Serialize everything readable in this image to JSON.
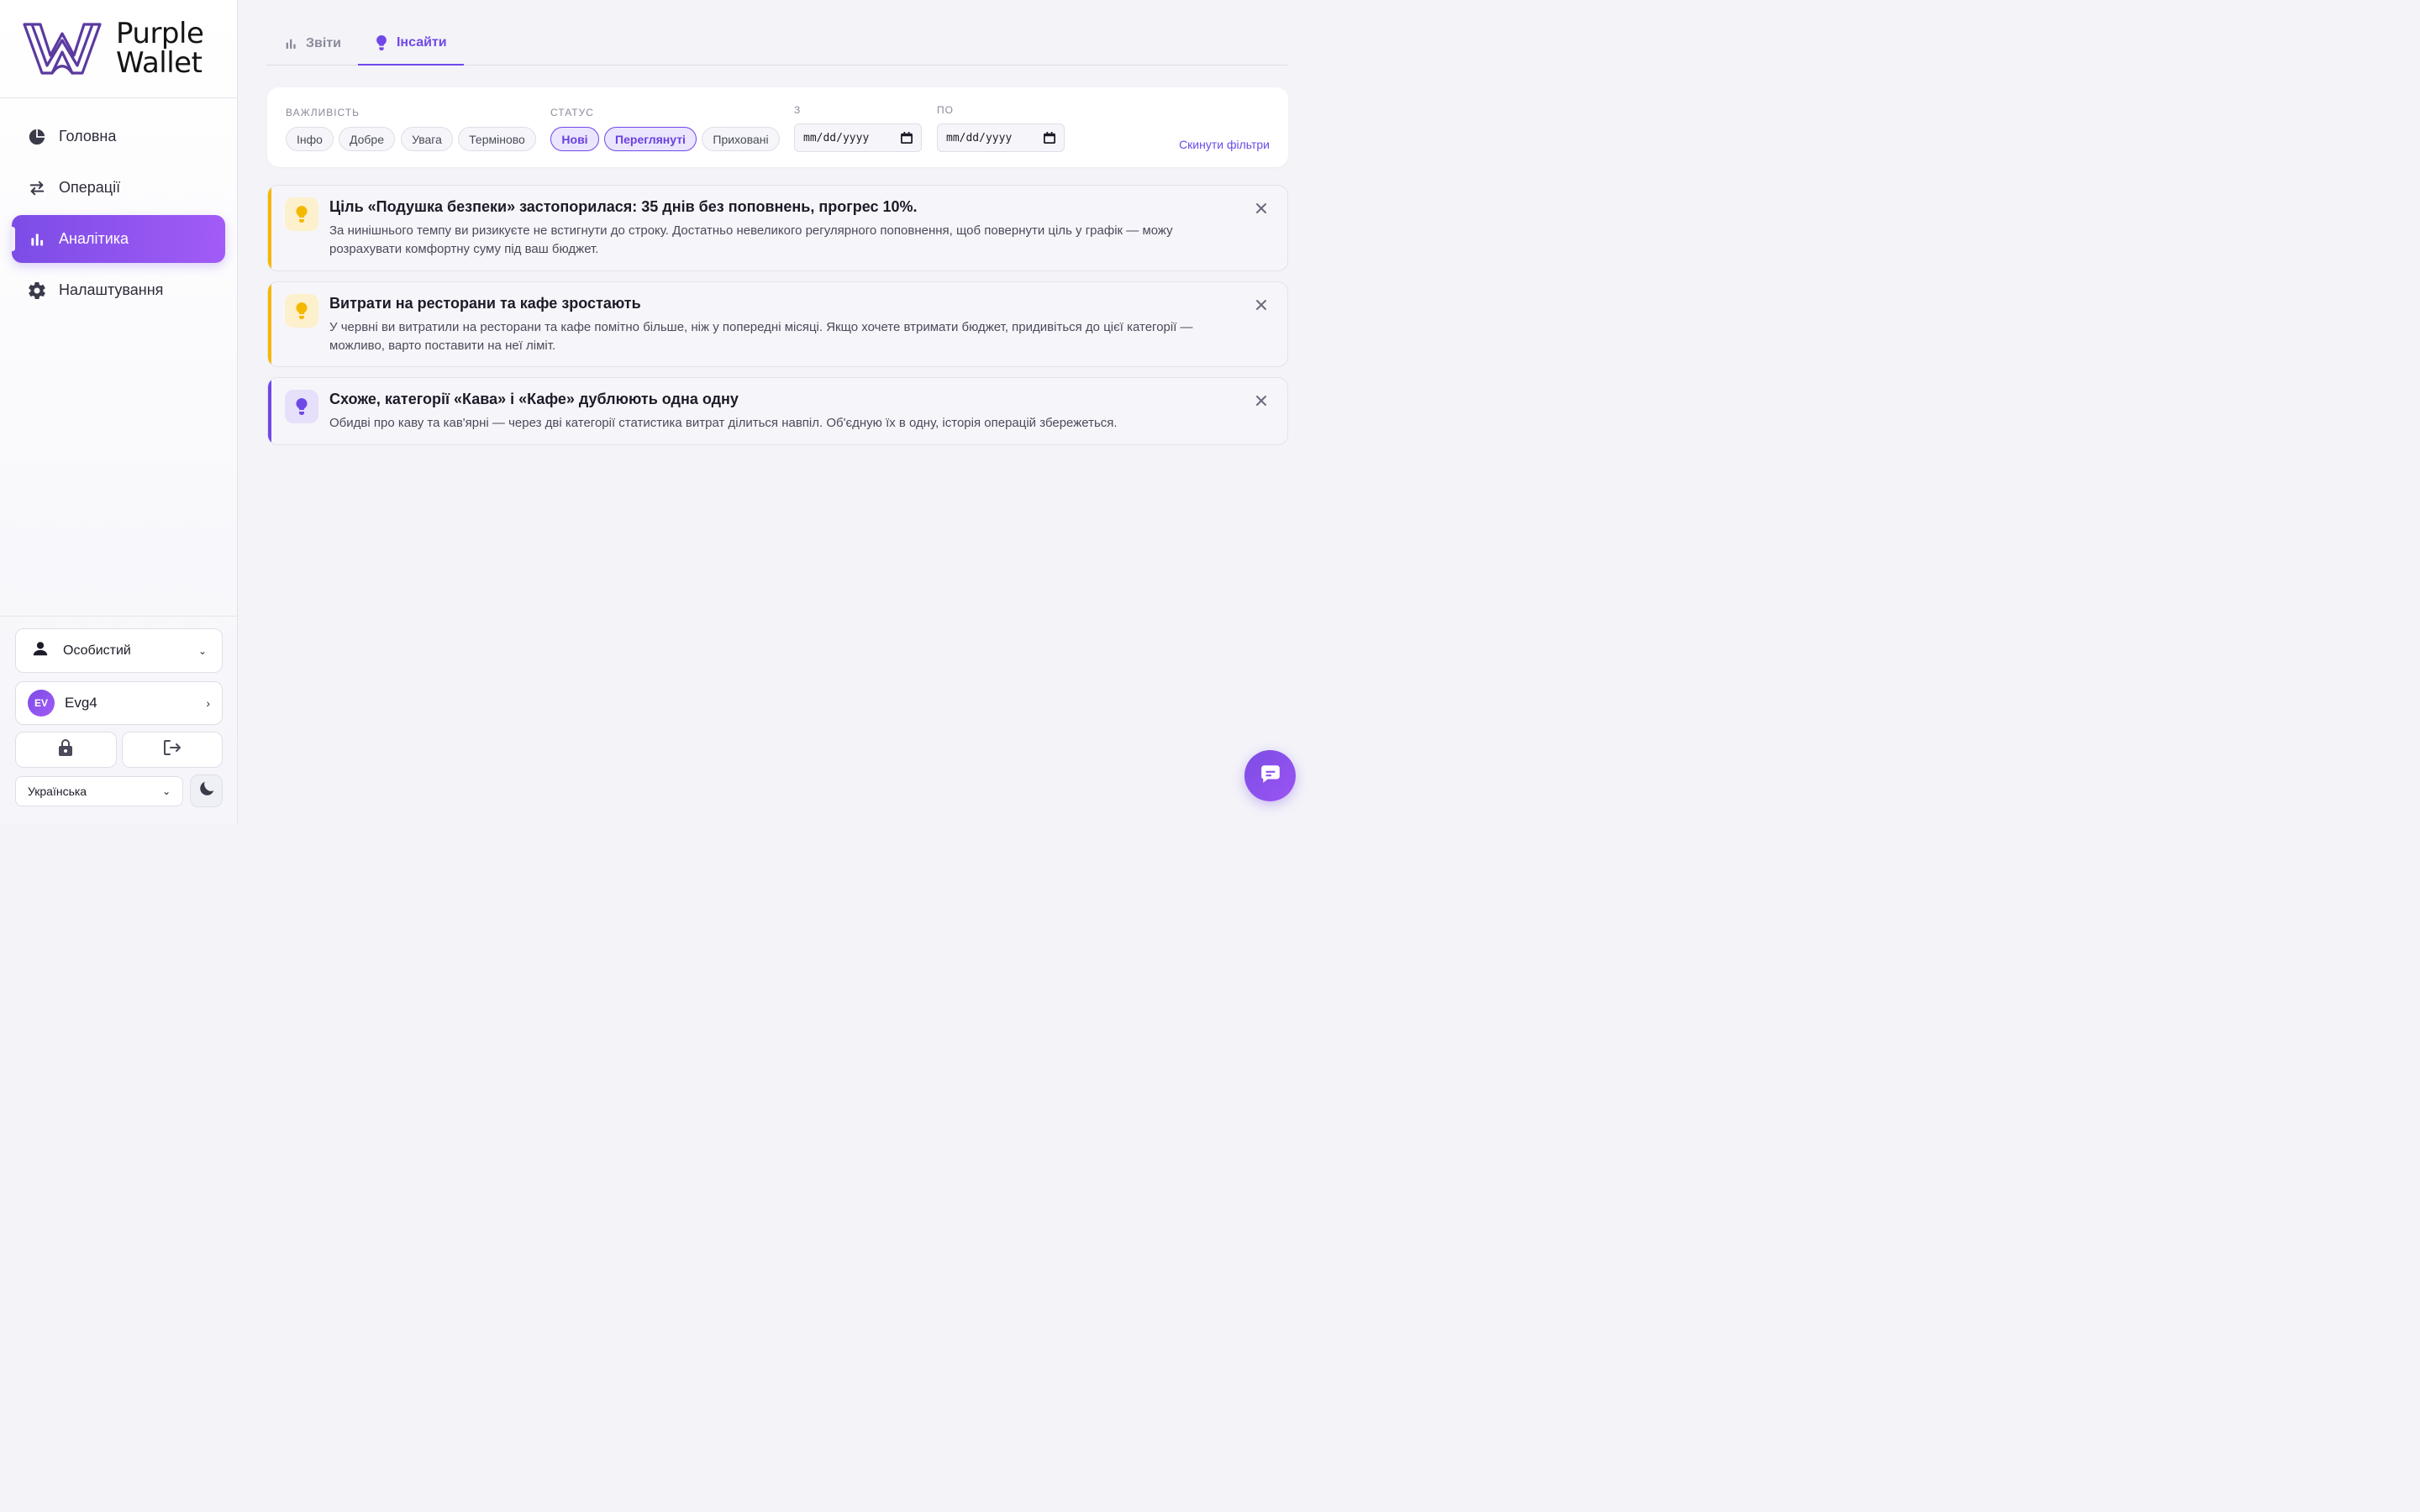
{
  "app": {
    "logo_line1": "Purple",
    "logo_line2": "Wallet"
  },
  "sidebar": {
    "items": [
      {
        "label": "Головна",
        "icon": "pie-chart-icon"
      },
      {
        "label": "Операції",
        "icon": "swap-arrows-icon"
      },
      {
        "label": "Аналітика",
        "icon": "bar-chart-icon",
        "active": true
      },
      {
        "label": "Налаштування",
        "icon": "gear-icon"
      }
    ],
    "account_selector": "Особистий",
    "user": {
      "initials": "EV",
      "name": "Evg4"
    },
    "language": "Українська"
  },
  "tabs": [
    {
      "label": "Звіти",
      "icon": "bar-chart-icon"
    },
    {
      "label": "Інсайти",
      "icon": "lightbulb-icon",
      "active": true
    }
  ],
  "filters": {
    "importance_label": "ВАЖЛИВІСТЬ",
    "importance_chips": [
      "Інфо",
      "Добре",
      "Увага",
      "Терміново"
    ],
    "status_label": "СТАТУС",
    "status_chips": [
      {
        "label": "Нові",
        "selected": true
      },
      {
        "label": "Переглянуті",
        "selected": true
      },
      {
        "label": "Приховані",
        "selected": false
      }
    ],
    "from_label": "З",
    "to_label": "ПО",
    "from_placeholder": "mm/dd/yyyy",
    "to_placeholder": "mm/dd/yyyy",
    "reset_label": "Скинути фільтри"
  },
  "insights": [
    {
      "title": "Ціль «Подушка безпеки» застопорилася: 35 днів без поповнень, прогрес 10%.",
      "body": "За нинішнього темпу ви ризикуєте не встигнути до строку. Достатньо невеликого регулярного поповнення, щоб повернути ціль у графік — можу розрахувати комфортну суму під ваш бюджет.",
      "accent": "#f5b800"
    },
    {
      "title": "Витрати на ресторани та кафе зростають",
      "body": "У червні ви витратили на ресторани та кафе помітно більше, ніж у попередні місяці. Якщо хочете втримати бюджет, придивіться до цієї категорії — можливо, варто поставити на неї ліміт.",
      "accent": "#f5b800"
    },
    {
      "title": "Схоже, категорії «Кава» і «Кафе» дублюють одна одну",
      "body": "Обидві про каву та кав'ярні — через дві категорії статистика витрат ділиться навпіл. Об'єдную їх в одну, історія операцій збережеться.",
      "accent": "#7048e8"
    }
  ],
  "colors": {
    "brand": "#7c4ce6",
    "warning": "#f5b800",
    "info": "#7048e8"
  }
}
